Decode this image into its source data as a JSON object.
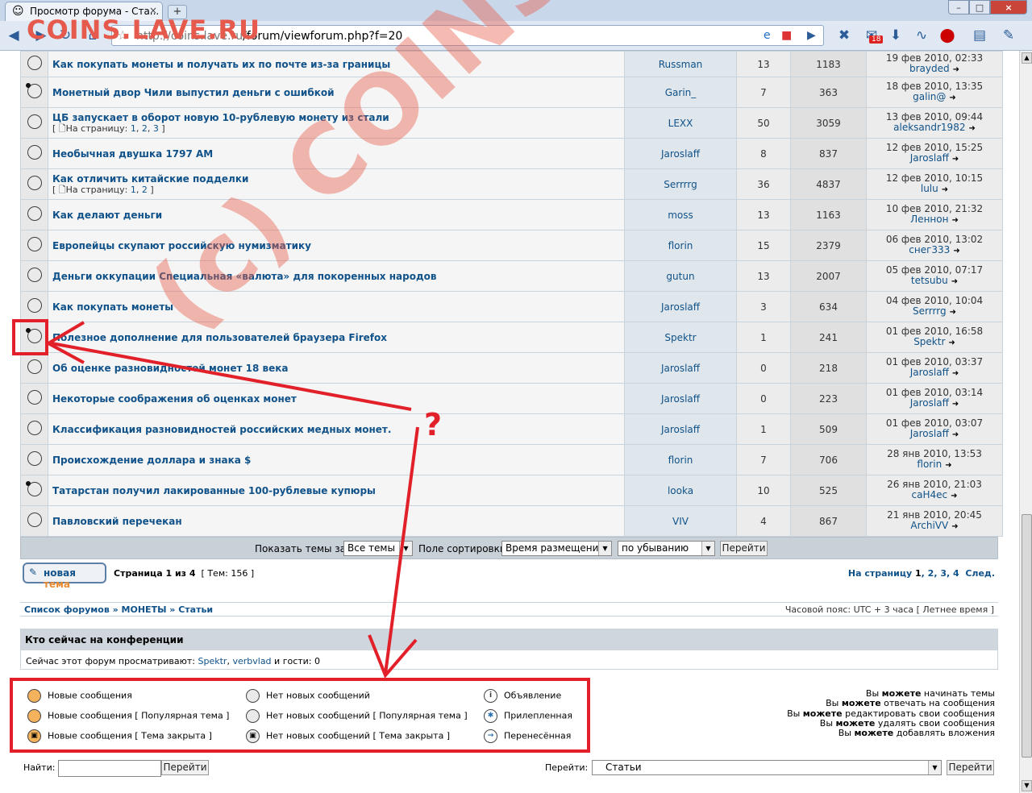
{
  "browser": {
    "tab_title": "Просмотр форума - Ста...",
    "tab_close": "×",
    "new_tab": "+",
    "url_prefix": "http://coins.lave.ru",
    "url_path": "/forum/viewforum.php?f=20",
    "badge_count": "18",
    "minimize": "–",
    "maximize": "□",
    "close": "×"
  },
  "watermark": {
    "logo": "COINS.LAVE.RU",
    "diagonal": "(c) COINS.LAVE.RU",
    "question_mark": "?"
  },
  "topics": [
    {
      "title": "Как покупать монеты и получать их по почте из-за границы",
      "pages": [],
      "author": "Russman",
      "replies": "13",
      "views": "1183",
      "last_date": "19 фев 2010, 02:33",
      "last_user": "brayded",
      "new": false
    },
    {
      "title": "Монетный двор Чили выпустил деньги с ошибкой",
      "pages": [],
      "author": "Garin_",
      "replies": "7",
      "views": "363",
      "last_date": "18 фев 2010, 13:35",
      "last_user": "galin@",
      "new": true
    },
    {
      "title": "ЦБ запускает в оборот новую 10-рублевую монету из стали",
      "pages": [
        "1",
        "2",
        "3"
      ],
      "author": "LEXX",
      "replies": "50",
      "views": "3059",
      "last_date": "13 фев 2010, 09:44",
      "last_user": "aleksandr1982",
      "new": false
    },
    {
      "title": "Необычная двушка 1797 АМ",
      "pages": [],
      "author": "Jaroslaff",
      "replies": "8",
      "views": "837",
      "last_date": "12 фев 2010, 15:25",
      "last_user": "Jaroslaff",
      "new": false
    },
    {
      "title": "Как отличить китайские подделки",
      "pages": [
        "1",
        "2"
      ],
      "author": "Serrrrg",
      "replies": "36",
      "views": "4837",
      "last_date": "12 фев 2010, 10:15",
      "last_user": "lulu",
      "new": false
    },
    {
      "title": "Как делают деньги",
      "pages": [],
      "author": "moss",
      "replies": "13",
      "views": "1163",
      "last_date": "10 фев 2010, 21:32",
      "last_user": "Леннон",
      "new": false
    },
    {
      "title": "Европейцы скупают российскую нумизматику",
      "pages": [],
      "author": "florin",
      "replies": "15",
      "views": "2379",
      "last_date": "06 фев 2010, 13:02",
      "last_user": "снег333",
      "new": false
    },
    {
      "title": "Деньги оккупации Специальная «валюта» для покоренных народов",
      "pages": [],
      "author": "gutun",
      "replies": "13",
      "views": "2007",
      "last_date": "05 фев 2010, 07:17",
      "last_user": "tetsubu",
      "new": false
    },
    {
      "title": "Как покупать монеты",
      "pages": [],
      "author": "Jaroslaff",
      "replies": "3",
      "views": "634",
      "last_date": "04 фев 2010, 10:04",
      "last_user": "Serrrrg",
      "new": false
    },
    {
      "title": "Полезное дополнение для пользователей браузера Firefox",
      "pages": [],
      "author": "Spektr",
      "replies": "1",
      "views": "241",
      "last_date": "01 фев 2010, 16:58",
      "last_user": "Spektr",
      "new": true
    },
    {
      "title": "Об оценке разновидностей монет 18 века",
      "pages": [],
      "author": "Jaroslaff",
      "replies": "0",
      "views": "218",
      "last_date": "01 фев 2010, 03:37",
      "last_user": "Jaroslaff",
      "new": false
    },
    {
      "title": "Некоторые соображения об оценках монет",
      "pages": [],
      "author": "Jaroslaff",
      "replies": "0",
      "views": "223",
      "last_date": "01 фев 2010, 03:14",
      "last_user": "Jaroslaff",
      "new": false
    },
    {
      "title": "Классификация разновидностей российских медных монет.",
      "pages": [],
      "author": "Jaroslaff",
      "replies": "1",
      "views": "509",
      "last_date": "01 фев 2010, 03:07",
      "last_user": "Jaroslaff",
      "new": false
    },
    {
      "title": "Происхождение доллара и знака $",
      "pages": [],
      "author": "florin",
      "replies": "7",
      "views": "706",
      "last_date": "28 янв 2010, 13:53",
      "last_user": "florin",
      "new": false
    },
    {
      "title": "Татарстан получил лакированные 100-рублевые купюры",
      "pages": [],
      "author": "looka",
      "replies": "10",
      "views": "525",
      "last_date": "26 янв 2010, 21:03",
      "last_user": "саН4ес",
      "new": true
    },
    {
      "title": "Павловский перечекан",
      "pages": [],
      "author": "VIV",
      "replies": "4",
      "views": "867",
      "last_date": "21 янв 2010, 20:45",
      "last_user": "ArchiVV",
      "new": false
    }
  ],
  "pages_prefix": "[ ",
  "pages_label": "На страницу: ",
  "pages_suffix": " ]",
  "filter": {
    "show_label": "Показать темы за:",
    "show_value": "Все темы",
    "sort_label": "Поле сортировки",
    "sort_value": "Время размещения",
    "order_value": "по убыванию",
    "go": "Перейти"
  },
  "new_topic": {
    "part1": "новая ",
    "part2": "тема"
  },
  "page_info": {
    "prefix": "Страница ",
    "current": "1",
    "of": " из ",
    "total": "4",
    "topics": "[ Тем: 156 ]"
  },
  "page_links": {
    "label": "На страницу ",
    "p1": "1",
    "p2": "2",
    "p3": "3",
    "p4": "4",
    "next": "След."
  },
  "breadcrumb": {
    "forums": "Список форумов",
    "sep": " » ",
    "cat": "МОНЕТЫ",
    "forum": "Статьи",
    "timezone": "Часовой пояс: UTC + 3 часа [ Летнее время ]"
  },
  "whois": {
    "title": "Кто сейчас на конференции",
    "text_prefix": "Сейчас этот форум просматривают: ",
    "user1": "Spektr",
    "user2": "verbvlad",
    "text_suffix": " и гости: 0"
  },
  "legend": {
    "new_posts": "Новые сообщения",
    "new_posts_hot": "Новые сообщения [ Популярная тема ]",
    "new_posts_locked": "Новые сообщения [ Тема закрыта ]",
    "no_new": "Нет новых сообщений",
    "no_new_hot": "Нет новых сообщений [ Популярная тема ]",
    "no_new_locked": "Нет новых сообщений [ Тема закрыта ]",
    "announce": "Объявление",
    "sticky": "Прилепленная",
    "moved": "Перенесённая"
  },
  "permissions": {
    "you": "Вы ",
    "can": "можете",
    "p1": " начинать темы",
    "p2": " отвечать на сообщения",
    "p3": " редактировать свои сообщения",
    "p4": " удалять свои сообщения",
    "p5": " добавлять вложения"
  },
  "search": {
    "label": "Найти:",
    "value": "",
    "go": "Перейти"
  },
  "jump": {
    "label": "Перейти:",
    "value": "Статьи",
    "go": "Перейти"
  },
  "colors": {
    "link": "#105289",
    "annotation_red": "#e2202a",
    "watermark": "#e55a4c"
  }
}
